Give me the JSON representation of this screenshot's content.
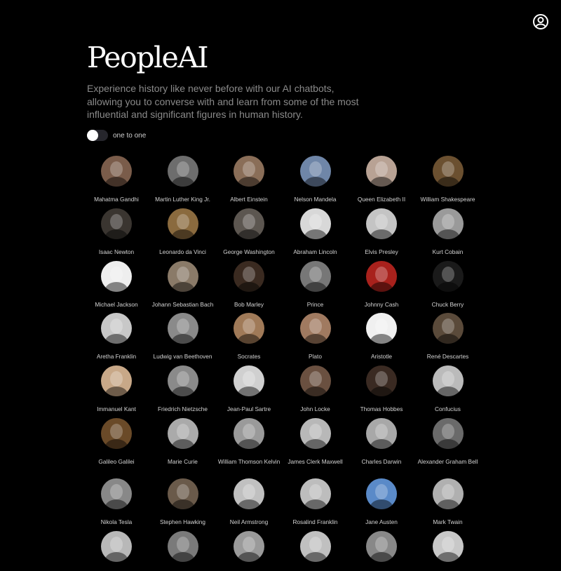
{
  "brand": {
    "logo": "PeopleAI"
  },
  "intro": {
    "tagline": "Experience history like never before with our AI chatbots, allowing you to converse with and learn from some of the most influential and significant figures in human history."
  },
  "mode_toggle": {
    "label": "one to one",
    "enabled": false
  },
  "account": {
    "icon": "user-account-icon"
  },
  "figures": [
    {
      "name": "Mahatma Gandhi",
      "color": "#7a5c4a"
    },
    {
      "name": "Martin Luther King Jr.",
      "color": "#6d6d6d"
    },
    {
      "name": "Albert Einstein",
      "color": "#8a6e58"
    },
    {
      "name": "Nelson Mandela",
      "color": "#6f86a8"
    },
    {
      "name": "Queen Elizabeth II",
      "color": "#b8a294"
    },
    {
      "name": "William Shakespeare",
      "color": "#6b5030"
    },
    {
      "name": "Isaac Newton",
      "color": "#3a3530"
    },
    {
      "name": "Leonardo da Vinci",
      "color": "#8a6a3e"
    },
    {
      "name": "George Washington",
      "color": "#5c5650"
    },
    {
      "name": "Abraham Lincoln",
      "color": "#d8d8d8"
    },
    {
      "name": "Elvis Presley",
      "color": "#c4c4c4"
    },
    {
      "name": "Kurt Cobain",
      "color": "#9a9a9a"
    },
    {
      "name": "Michael Jackson",
      "color": "#eeeeee"
    },
    {
      "name": "Johann Sebastian Bach",
      "color": "#8a7a68"
    },
    {
      "name": "Bob Marley",
      "color": "#3a2a20"
    },
    {
      "name": "Prince",
      "color": "#777777"
    },
    {
      "name": "Johnny Cash",
      "color": "#a8211c"
    },
    {
      "name": "Chuck Berry",
      "color": "#1a1a1a"
    },
    {
      "name": "Aretha Franklin",
      "color": "#c8c8c8"
    },
    {
      "name": "Ludwig van Beethoven",
      "color": "#8a8a8a"
    },
    {
      "name": "Socrates",
      "color": "#a07a58"
    },
    {
      "name": "Plato",
      "color": "#a07a60"
    },
    {
      "name": "Aristotle",
      "color": "#f0f0f0"
    },
    {
      "name": "René Descartes",
      "color": "#5a4a3a"
    },
    {
      "name": "Immanuel Kant",
      "color": "#c8a888"
    },
    {
      "name": "Friedrich Nietzsche",
      "color": "#8a8a8a"
    },
    {
      "name": "Jean-Paul Sartre",
      "color": "#d0d0d0"
    },
    {
      "name": "John Locke",
      "color": "#6a5040"
    },
    {
      "name": "Thomas Hobbes",
      "color": "#3a2a22"
    },
    {
      "name": "Confucius",
      "color": "#bbbbbb"
    },
    {
      "name": "Galileo Galilei",
      "color": "#6a4a28"
    },
    {
      "name": "Marie Curie",
      "color": "#aaaaaa"
    },
    {
      "name": "William Thomson Kelvin",
      "color": "#9a9a9a"
    },
    {
      "name": "James Clerk Maxwell",
      "color": "#b8b8b8"
    },
    {
      "name": "Charles Darwin",
      "color": "#a8a8a8"
    },
    {
      "name": "Alexander Graham Bell",
      "color": "#6a6a6a"
    },
    {
      "name": "Nikola Tesla",
      "color": "#888888"
    },
    {
      "name": "Stephen Hawking",
      "color": "#6a5a4a"
    },
    {
      "name": "Neil Armstrong",
      "color": "#c0c0c0"
    },
    {
      "name": "Rosalind Franklin",
      "color": "#bdbdbd"
    },
    {
      "name": "Jane Austen",
      "color": "#5a8ac8"
    },
    {
      "name": "Mark Twain",
      "color": "#b0b0b0"
    },
    {
      "name": "",
      "color": "#b8b8b8"
    },
    {
      "name": "",
      "color": "#7a7a7a"
    },
    {
      "name": "",
      "color": "#9a9a9a"
    },
    {
      "name": "",
      "color": "#c0c0c0"
    },
    {
      "name": "",
      "color": "#888888"
    },
    {
      "name": "",
      "color": "#c8c8c8"
    }
  ]
}
